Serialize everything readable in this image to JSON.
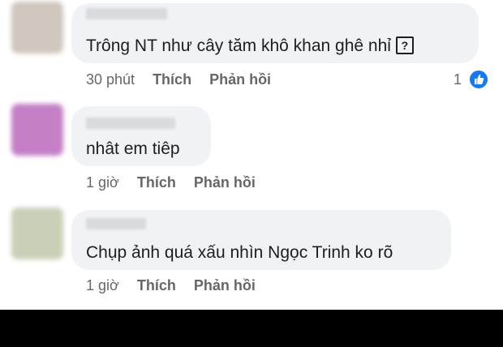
{
  "comments": [
    {
      "text": "Trông NT như cây tăm khô khan ghê nhỉ",
      "trailing_glyph": "?",
      "time": "30 phút",
      "like_label": "Thích",
      "reply_label": "Phản hồi",
      "like_count": "1",
      "avatar_color": "#cfc6bd"
    },
    {
      "text": "nhât em tiêp",
      "time": "1 giờ",
      "like_label": "Thích",
      "reply_label": "Phản hồi",
      "avatar_color": "#c47fc7"
    },
    {
      "text": "Chụp ảnh quá xấu nhìn Ngọc Trinh ko rõ",
      "time": "1 giờ",
      "like_label": "Thích",
      "reply_label": "Phản hồi",
      "avatar_color": "#c9d0b7"
    }
  ],
  "colors": {
    "bubble": "#f0f2f5",
    "like_blue": "#1877f2",
    "meta_text": "#65676b"
  }
}
